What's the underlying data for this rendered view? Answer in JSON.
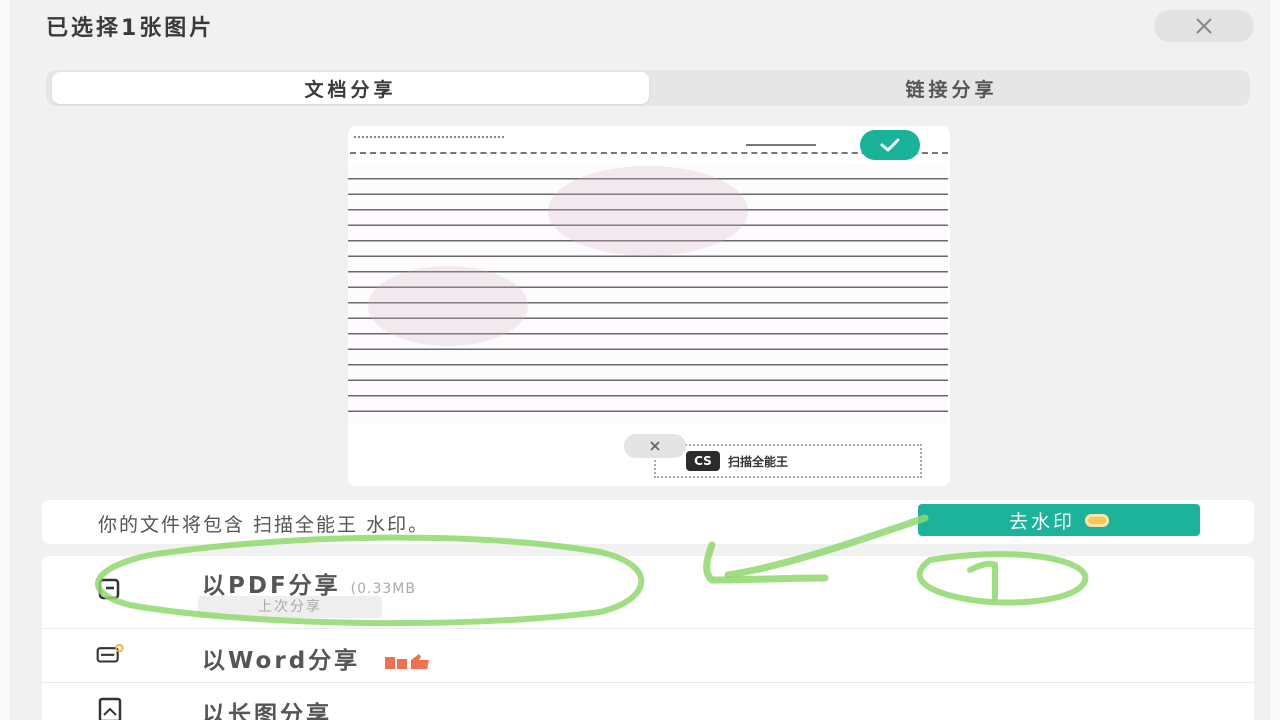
{
  "header": {
    "title": "已选择1张图片",
    "close_icon": "close-icon"
  },
  "tabs": [
    {
      "label": "文档分享",
      "active": true
    },
    {
      "label": "链接分享",
      "active": false
    }
  ],
  "preview": {
    "selected_icon": "check-icon",
    "watermark_close_icon": "close-icon",
    "watermark_logo": "CS",
    "watermark_text": "扫描全能王"
  },
  "notice": {
    "text": "你的文件将包含 扫描全能王 水印。",
    "button_label": "去水印",
    "button_icon": "coin-icon"
  },
  "options": [
    {
      "label": "以PDF分享",
      "size": "(0.33MB",
      "tag": "上次分享",
      "icon": "pdf-icon"
    },
    {
      "label": "以Word分享",
      "icon": "word-icon",
      "badge_icon": "thumbs-up-icon"
    },
    {
      "label": "以长图分享",
      "icon": "long-image-icon"
    }
  ],
  "colors": {
    "accent": "#1db39a",
    "annotation": "#8fd86e",
    "background": "#f1f1f1"
  }
}
